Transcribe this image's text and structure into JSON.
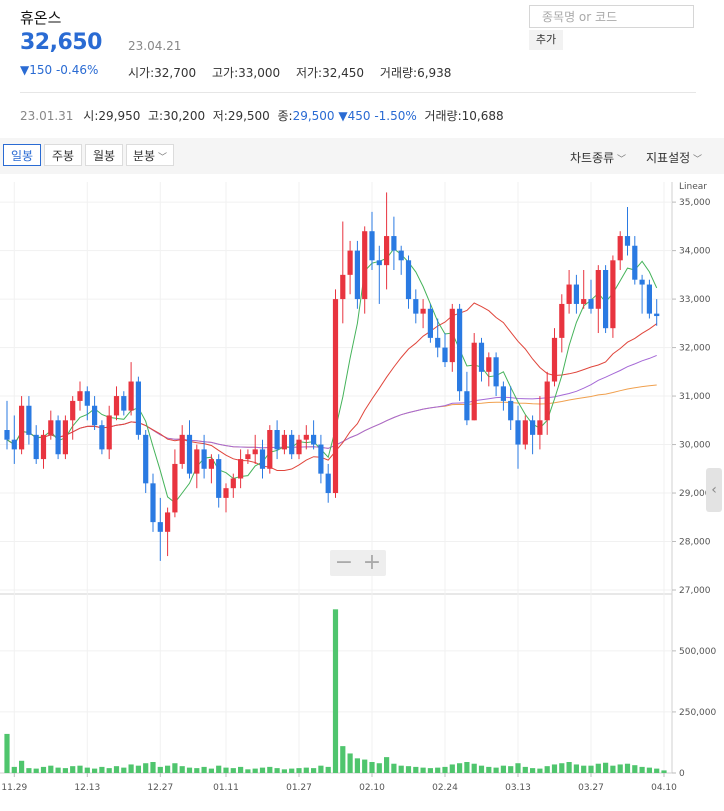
{
  "header": {
    "stock_name": "휴온스",
    "price": "32,650",
    "date": "23.04.21",
    "change": "▼150 -0.46%",
    "ohlc": [
      {
        "label": "시가",
        "value": "32,700"
      },
      {
        "label": "고가",
        "value": "33,000"
      },
      {
        "label": "저가",
        "value": "32,450"
      },
      {
        "label": "거래량",
        "value": "6,938"
      }
    ],
    "search_placeholder": "종목명 or 코드",
    "add_label": "추가"
  },
  "prev": {
    "date": "23.01.31",
    "open_label": "시",
    "open": "29,950",
    "high_label": "고",
    "high": "30,200",
    "low_label": "저",
    "low": "29,500",
    "close_label": "종",
    "close": "29,500",
    "change": "▼450 -1.50%",
    "volume_label": "거래량",
    "volume": "10,688"
  },
  "toolbar": {
    "tabs": [
      "일봉",
      "주봉",
      "월봉",
      "분봉"
    ],
    "chart_type": "차트종류",
    "indicator": "지표설정"
  },
  "colors": {
    "up": "#e8343f",
    "down": "#2a7ae2",
    "ma5": "#45b35a",
    "ma20": "#e0463c",
    "ma60": "#a569d6",
    "ma120": "#f0a04e",
    "volume": "#4fc56d",
    "accent": "#2a6bd3"
  },
  "chart_data": {
    "type": "candlestick",
    "scale_label": "Linear",
    "price_ticks": [
      27000,
      28000,
      29000,
      30000,
      31000,
      32000,
      33000,
      34000,
      35000
    ],
    "price_tick_labels": [
      "27,000",
      "28,000",
      "29,000",
      "30,000",
      "31,000",
      "32,000",
      "33,000",
      "34,000",
      "35,000"
    ],
    "volume_ticks": [
      0,
      250000,
      500000
    ],
    "volume_tick_labels": [
      "0",
      "250,000",
      "500,000"
    ],
    "date_labels": [
      {
        "i": 1,
        "label": "11.29"
      },
      {
        "i": 11,
        "label": "12.13"
      },
      {
        "i": 21,
        "label": "12.27"
      },
      {
        "i": 30,
        "label": "01.11"
      },
      {
        "i": 40,
        "label": "01.27"
      },
      {
        "i": 50,
        "label": "02.10"
      },
      {
        "i": 60,
        "label": "02.24"
      },
      {
        "i": 70,
        "label": "03.13"
      },
      {
        "i": 80,
        "label": "03.27"
      },
      {
        "i": 90,
        "label": "04.10"
      }
    ],
    "ohlc": [
      [
        30300,
        30900,
        29900,
        30100
      ],
      [
        30100,
        30600,
        29600,
        29900
      ],
      [
        29900,
        31000,
        29800,
        30800
      ],
      [
        30800,
        31000,
        30000,
        30200
      ],
      [
        30200,
        30400,
        29600,
        29700
      ],
      [
        29700,
        30300,
        29500,
        30200
      ],
      [
        30200,
        30700,
        30100,
        30500
      ],
      [
        30500,
        30600,
        29700,
        29800
      ],
      [
        29800,
        30600,
        29700,
        30500
      ],
      [
        30500,
        31000,
        30100,
        30900
      ],
      [
        30900,
        31300,
        30700,
        31100
      ],
      [
        31100,
        31200,
        30500,
        30800
      ],
      [
        30800,
        31000,
        30300,
        30400
      ],
      [
        30400,
        30500,
        29800,
        29900
      ],
      [
        29900,
        30800,
        29700,
        30600
      ],
      [
        30600,
        31200,
        30500,
        31000
      ],
      [
        31000,
        31100,
        30600,
        30700
      ],
      [
        30700,
        31700,
        30600,
        31300
      ],
      [
        31300,
        31400,
        30100,
        30200
      ],
      [
        30200,
        30300,
        29000,
        29200
      ],
      [
        29200,
        29400,
        28200,
        28400
      ],
      [
        28400,
        28900,
        27600,
        28200
      ],
      [
        28200,
        28700,
        27700,
        28600
      ],
      [
        28600,
        29900,
        28500,
        29600
      ],
      [
        29600,
        30400,
        29500,
        30200
      ],
      [
        30200,
        30500,
        29300,
        29400
      ],
      [
        29400,
        30000,
        29100,
        29900
      ],
      [
        29900,
        30200,
        29300,
        29500
      ],
      [
        29500,
        29800,
        29200,
        29700
      ],
      [
        29700,
        29800,
        28700,
        28900
      ],
      [
        28900,
        29200,
        28600,
        29100
      ],
      [
        29100,
        29400,
        28900,
        29300
      ],
      [
        29300,
        29900,
        29100,
        29700
      ],
      [
        29700,
        29900,
        29600,
        29800
      ],
      [
        29800,
        30200,
        29600,
        29900
      ],
      [
        29900,
        30100,
        29300,
        29500
      ],
      [
        29500,
        30400,
        29400,
        30300
      ],
      [
        30300,
        30500,
        29700,
        29900
      ],
      [
        29900,
        30300,
        29800,
        30200
      ],
      [
        30200,
        30300,
        29700,
        29800
      ],
      [
        29800,
        30200,
        29700,
        30100
      ],
      [
        30100,
        30400,
        29900,
        30200
      ],
      [
        30200,
        30500,
        29900,
        30000
      ],
      [
        30000,
        30200,
        29200,
        29400
      ],
      [
        29400,
        29600,
        28800,
        29000
      ],
      [
        29000,
        33200,
        28900,
        33000
      ],
      [
        33000,
        34600,
        32500,
        33500
      ],
      [
        33500,
        34200,
        33100,
        34000
      ],
      [
        34000,
        34200,
        32800,
        33000
      ],
      [
        33000,
        34500,
        32700,
        34400
      ],
      [
        34400,
        34800,
        33600,
        33800
      ],
      [
        33800,
        34100,
        32900,
        33700
      ],
      [
        33700,
        35200,
        33200,
        34300
      ],
      [
        34300,
        34700,
        33600,
        34000
      ],
      [
        34000,
        34100,
        33500,
        33800
      ],
      [
        33800,
        33900,
        32800,
        33000
      ],
      [
        33000,
        33200,
        32500,
        32700
      ],
      [
        32700,
        33000,
        32400,
        32800
      ],
      [
        32800,
        32900,
        32100,
        32200
      ],
      [
        32200,
        32600,
        31800,
        32000
      ],
      [
        32000,
        32300,
        31600,
        31700
      ],
      [
        31700,
        32900,
        31500,
        32800
      ],
      [
        32800,
        32900,
        30900,
        31100
      ],
      [
        31100,
        31500,
        30400,
        30500
      ],
      [
        30500,
        32300,
        30500,
        32100
      ],
      [
        32100,
        32200,
        31300,
        31500
      ],
      [
        31500,
        31900,
        31200,
        31800
      ],
      [
        31800,
        31900,
        31000,
        31200
      ],
      [
        31200,
        31300,
        30700,
        30900
      ],
      [
        30900,
        31200,
        30300,
        30500
      ],
      [
        30500,
        30800,
        29500,
        30000
      ],
      [
        30000,
        30600,
        29900,
        30500
      ],
      [
        30500,
        30600,
        29800,
        30200
      ],
      [
        30200,
        31000,
        29900,
        30500
      ],
      [
        30500,
        31500,
        30200,
        31300
      ],
      [
        31300,
        32400,
        31200,
        32200
      ],
      [
        32200,
        33100,
        31900,
        32900
      ],
      [
        32900,
        33600,
        32700,
        33300
      ],
      [
        33300,
        33500,
        32700,
        32900
      ],
      [
        32900,
        33600,
        32800,
        33000
      ],
      [
        33000,
        33400,
        32700,
        32800
      ],
      [
        32800,
        33700,
        32300,
        33600
      ],
      [
        33600,
        33700,
        32300,
        32400
      ],
      [
        32400,
        33900,
        32200,
        33800
      ],
      [
        33800,
        34400,
        33600,
        34300
      ],
      [
        34300,
        34900,
        33900,
        34100
      ],
      [
        34100,
        34300,
        33300,
        33400
      ],
      [
        33400,
        33500,
        32700,
        33300
      ],
      [
        33300,
        33400,
        32600,
        32700
      ],
      [
        32700,
        33000,
        32450,
        32650
      ]
    ],
    "volume": [
      160000,
      25000,
      50000,
      20000,
      18000,
      25000,
      30000,
      22000,
      20000,
      28000,
      30000,
      22000,
      18000,
      25000,
      20000,
      28000,
      22000,
      35000,
      30000,
      40000,
      45000,
      25000,
      30000,
      40000,
      28000,
      22000,
      20000,
      25000,
      18000,
      30000,
      22000,
      20000,
      25000,
      15000,
      18000,
      22000,
      25000,
      20000,
      15000,
      18000,
      20000,
      22000,
      20000,
      30000,
      25000,
      670000,
      110000,
      80000,
      60000,
      55000,
      45000,
      40000,
      65000,
      38000,
      30000,
      28000,
      25000,
      22000,
      20000,
      22000,
      25000,
      35000,
      40000,
      45000,
      38000,
      30000,
      25000,
      22000,
      30000,
      28000,
      40000,
      25000,
      20000,
      18000,
      28000,
      35000,
      40000,
      45000,
      35000,
      30000,
      30000,
      38000,
      42000,
      30000,
      35000,
      38000,
      32000,
      25000,
      22000,
      18000,
      10688
    ]
  }
}
